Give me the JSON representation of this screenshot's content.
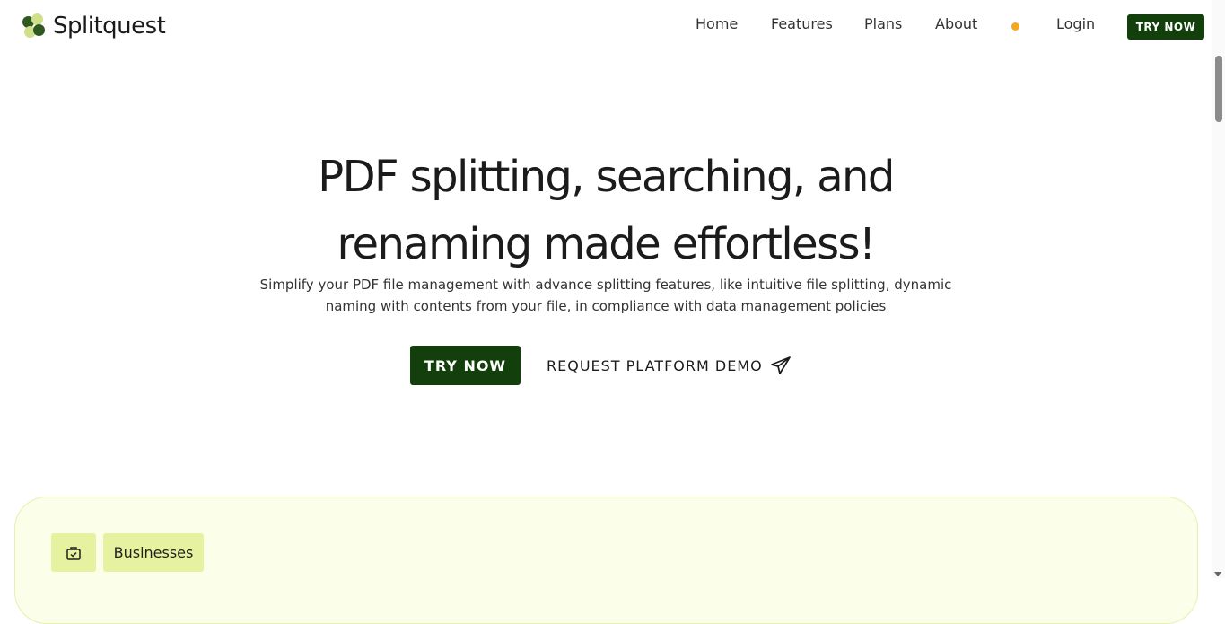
{
  "brand": {
    "name": "Splitquest",
    "logo_icon": "four-circles-logo-icon"
  },
  "nav": {
    "home": "Home",
    "features": "Features",
    "plans": "Plans",
    "about": "About",
    "login": "Login",
    "try_now": "TRY NOW"
  },
  "hero": {
    "title_line1": "PDF splitting, searching, and",
    "title_line2": "renaming made effortless!",
    "subtitle": "Simplify your PDF file management with advance splitting features, like intuitive file splitting, dynamic naming with contents from your file, in compliance with data management policies",
    "try_now": "TRY NOW",
    "demo": "REQUEST PLATFORM DEMO",
    "demo_icon": "paper-plane-icon"
  },
  "section": {
    "chip_icon": "briefcase-check-icon",
    "chip_label": "Businesses"
  },
  "colors": {
    "primary": "#123f0c",
    "accent_dot": "#f5a623",
    "card_bg": "#fbfee8",
    "chip_bg": "#e7f2a0"
  }
}
